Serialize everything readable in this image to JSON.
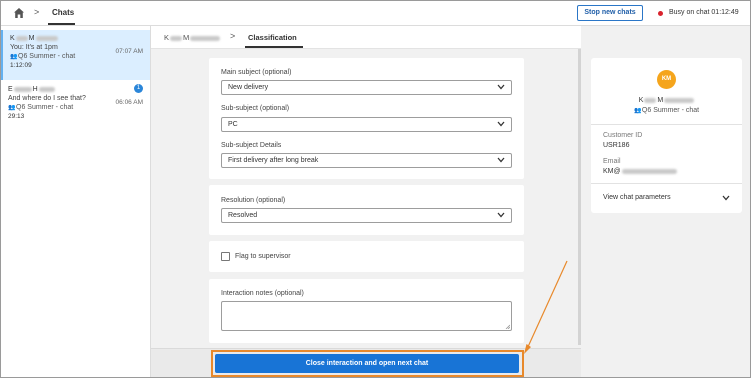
{
  "topbar": {
    "breadcrumb_separator": ">",
    "section_title": "Chats",
    "stop_button_label": "Stop new chats",
    "status_text": "Busy on chat 01:12:49",
    "status_color": "#d9232d"
  },
  "chat_list": [
    {
      "name_first": "K",
      "name_last": "M",
      "message": "You: It's at 1pm",
      "time": "07:07 AM",
      "queue": "Q6 Summer - chat",
      "duration": "1:12:09",
      "active": true,
      "badge": ""
    },
    {
      "name_first": "E",
      "name_last": "H",
      "message": "And where do I see that?",
      "time": "06:06 AM",
      "queue": "Q6 Summer - chat",
      "duration": "29:13",
      "active": false,
      "badge": "1"
    }
  ],
  "main": {
    "customer_name_first": "K",
    "customer_name_last": "M",
    "breadcrumb_separator": ">",
    "active_tab": "Classification",
    "fields": {
      "main_subject_label": "Main subject (optional)",
      "main_subject_value": "New delivery",
      "sub_subject_label": "Sub-subject (optional)",
      "sub_subject_value": "PC",
      "sub_subject_details_label": "Sub-subject Details",
      "sub_subject_details_value": "First delivery after long break",
      "resolution_label": "Resolution (optional)",
      "resolution_value": "Resolved",
      "flag_label": "Flag to supervisor",
      "notes_label": "Interaction notes (optional)",
      "notes_value": ""
    },
    "close_button_label": "Close interaction and open next chat",
    "accent_color": "#1874d6",
    "highlight_color": "#e8892b"
  },
  "customer": {
    "initials": "KM",
    "name_first": "K",
    "name_last": "M",
    "queue": "Q6 Summer - chat",
    "customer_id_label": "Customer ID",
    "customer_id_value": "USR186",
    "email_label": "Email",
    "email_value": "KM@",
    "view_params_label": "View chat parameters",
    "avatar_color": "#f5a51c"
  }
}
